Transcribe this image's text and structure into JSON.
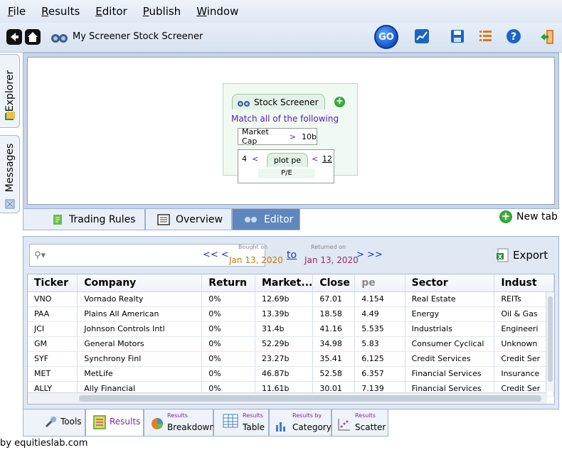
{
  "menu": [
    "File",
    "Results",
    "Editor",
    "Publish",
    "Window"
  ],
  "toolbar": {
    "title": "My Screener Stock Screener",
    "go_label": "GO"
  },
  "side_tabs": {
    "explorer": "Explorer",
    "messages": "Messages"
  },
  "screener": {
    "tab_label": "Stock Screener",
    "match_text": "Match all of the following",
    "rule1": {
      "field": "Market Cap",
      "op": ">",
      "value": "10b"
    },
    "rule2": {
      "low": "4",
      "low_op": "<",
      "field": "plot pe",
      "high_op": "<",
      "high": "12",
      "caption": "P/E"
    }
  },
  "editor_tabs": [
    "Trading Rules",
    "Overview",
    "Editor"
  ],
  "new_tab_label": "New tab",
  "results": {
    "search_placeholder": "",
    "prev_label": "<< <",
    "bought_on_label": "Bought on",
    "bought_date": "Jan 13, 2020",
    "to_label": "to",
    "returned_on_label": "Returned on",
    "returned_date": "Jan 13, 2020",
    "next_label": "> >>",
    "export_label": "Export",
    "sort_marker": "^1",
    "columns": [
      "Ticker",
      "Company",
      "Return",
      "Market...",
      "Close",
      "pe",
      "Sector",
      "Indust"
    ],
    "rows": [
      [
        "VNO",
        "Vornado Realty",
        "0%",
        "12.69b",
        "67.01",
        "4.154",
        "Real Estate",
        "REITs"
      ],
      [
        "PAA",
        "Plains All American",
        "0%",
        "13.39b",
        "18.58",
        "4.49",
        "Energy",
        "Oil & Gas"
      ],
      [
        "JCI",
        "Johnson Controls Intl",
        "0%",
        "31.4b",
        "41.16",
        "5.535",
        "Industrials",
        "Engineeri"
      ],
      [
        "GM",
        "General Motors",
        "0%",
        "52.29b",
        "34.98",
        "5.83",
        "Consumer Cyclical",
        "Unknown"
      ],
      [
        "SYF",
        "Synchrony Finl",
        "0%",
        "23.27b",
        "35.41",
        "6.125",
        "Credit Services",
        "Credit Ser"
      ],
      [
        "MET",
        "MetLife",
        "0%",
        "46.87b",
        "52.58",
        "6.357",
        "Financial Services",
        "Insurance"
      ],
      [
        "ALLY",
        "Ally Financial",
        "0%",
        "11.61b",
        "30.01",
        "7.139",
        "Financial Services",
        "Credit Ser"
      ]
    ]
  },
  "bottom_tabs": {
    "tools": "Tools",
    "results": "Results",
    "breakdown_small": "Results",
    "breakdown": "Breakdown",
    "table_small": "Results",
    "table": "Table",
    "category_small": "Results by",
    "category": "Category",
    "scatter_small": "Results",
    "scatter": "Scatter"
  },
  "footer": "by equitieslab.com"
}
